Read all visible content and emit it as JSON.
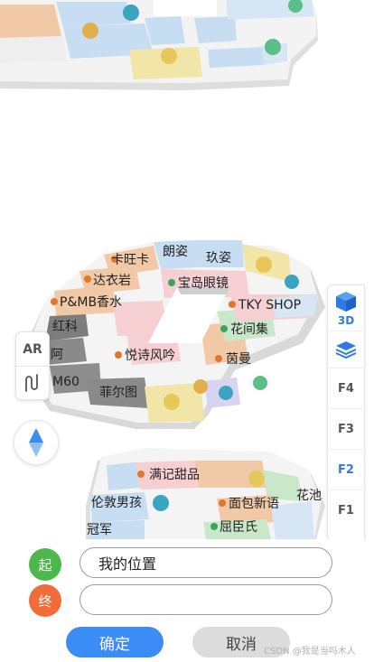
{
  "map": {
    "labels": {
      "langzi": "朗姿",
      "jiuzi": "玖姿",
      "kawangka": "卡旺卡",
      "dayiyan": "达衣岩",
      "baodao": "宝岛眼镜",
      "pmb": "P&MB香水",
      "hongke": "红科",
      "tkyshop": "TKY SHOP",
      "huajianji": "花间集",
      "yueshi": "悦诗风吟",
      "yinman": "茵曼",
      "m60": "M60",
      "feiertu": "菲尔图",
      "manji": "满记甜品",
      "lundun": "伦敦男孩",
      "mianbao": "面包新语",
      "huachi": "花池",
      "qucheng": "屈臣氏",
      "guanjun": "冠军",
      "partial": "阿"
    }
  },
  "controls": {
    "ar_label": "AR",
    "mode_3d_label": "3D",
    "floors": [
      "F4",
      "F3",
      "F2",
      "F1"
    ],
    "active_floor": "F2"
  },
  "route": {
    "start_badge": "起",
    "end_badge": "终",
    "start_value": "我的位置",
    "end_value": "",
    "confirm_label": "确定",
    "cancel_label": "取消"
  },
  "watermark": "CSDN @我是当吗木人",
  "colors": {
    "accent": "#2f7be3",
    "start": "#4cb84c",
    "end": "#f26b3a"
  }
}
